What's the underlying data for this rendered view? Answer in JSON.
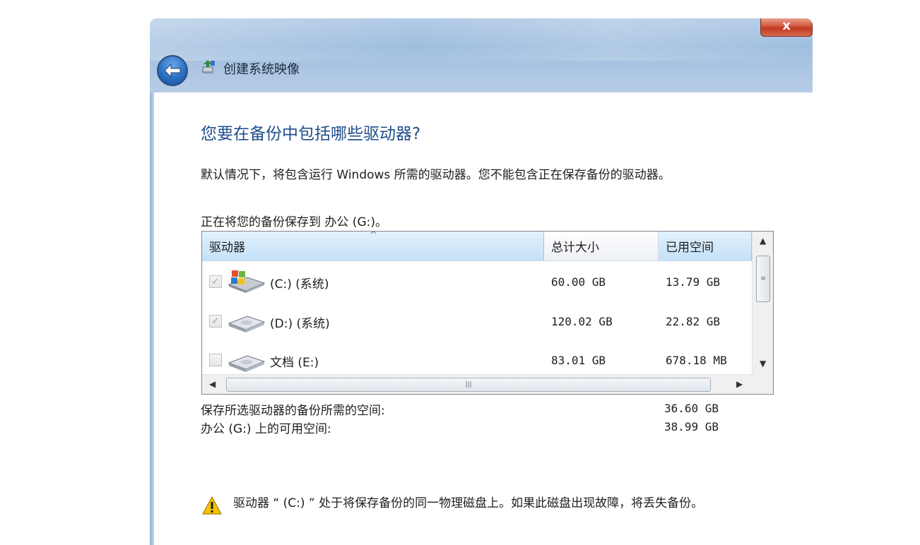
{
  "window": {
    "title": "创建系统映像",
    "close_label": "x"
  },
  "page": {
    "heading": "您要在备份中包括哪些驱动器?",
    "description": "默认情况下，将包含运行 Windows 所需的驱动器。您不能包含正在保存备份的驱动器。",
    "saving_to": "正在将您的备份保存到 办公 (G:)。"
  },
  "table": {
    "columns": [
      "驱动器",
      "总计大小",
      "已用空间"
    ],
    "rows": [
      {
        "name": "(C:) (系统)",
        "total": "60.00 GB",
        "used": "13.79 GB",
        "checked": true,
        "icon": "windows-drive-icon"
      },
      {
        "name": "(D:) (系统)",
        "total": "120.02 GB",
        "used": "22.82 GB",
        "checked": true,
        "icon": "hard-drive-icon"
      },
      {
        "name": "文档 (E:)",
        "total": "83.01 GB",
        "used": "678.18 MB",
        "checked": false,
        "icon": "hard-drive-icon"
      }
    ]
  },
  "summary": {
    "required_label": "保存所选驱动器的备份所需的空间:",
    "required_value": "36.60 GB",
    "available_label": "办公 (G:) 上的可用空间:",
    "available_value": "38.99 GB"
  },
  "warning": {
    "text": "驱动器 “ (C:) ” 处于将保存备份的同一物理磁盘上。如果此磁盘出现故障，将丢失备份。"
  },
  "colors": {
    "heading": "#1f4e8c",
    "warning_icon": "#f5c400"
  }
}
